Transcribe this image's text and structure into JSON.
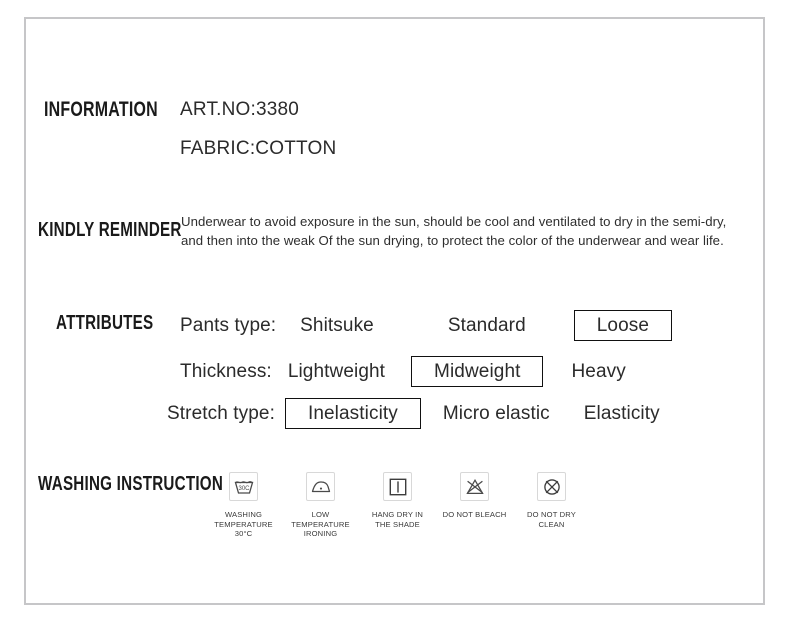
{
  "panel": {
    "border_color": "#c6c6c8",
    "text_color": "#2b2b2b"
  },
  "sections": {
    "information": {
      "heading": "INFORMATION",
      "art_no": "ART.NO:3380",
      "fabric": "FABRIC:COTTON"
    },
    "kindly_reminder": {
      "heading": "KINDLY REMINDER",
      "line1": "Underwear to avoid exposure in the sun, should be cool and ventilated to dry in the semi-dry,",
      "line2": "and then into the weak Of the sun drying, to protect the color of the underwear and wear life."
    },
    "attributes": {
      "heading": "ATTRIBUTES",
      "rows": [
        {
          "label": "Pants type:",
          "options": [
            {
              "text": "Shitsuke",
              "selected": false
            },
            {
              "text": "Standard",
              "selected": false
            },
            {
              "text": "Loose",
              "selected": true
            }
          ]
        },
        {
          "label": "Thickness:",
          "options": [
            {
              "text": "Lightweight",
              "selected": false
            },
            {
              "text": "Midweight",
              "selected": true
            },
            {
              "text": "Heavy",
              "selected": false
            }
          ]
        },
        {
          "label": "Stretch type:",
          "options": [
            {
              "text": "Inelasticity",
              "selected": true
            },
            {
              "text": "Micro elastic",
              "selected": false
            },
            {
              "text": "Elasticity",
              "selected": false
            }
          ]
        }
      ]
    },
    "washing_instruction": {
      "heading": "WASHING INSTRUCTION",
      "icons": [
        {
          "icon": "wash-tub-30c-icon",
          "caption": "WASHING\nTEMPERATURE 30°C"
        },
        {
          "icon": "low-temperature-iron-icon",
          "caption": "LOW TEMPERATURE\nIRONING"
        },
        {
          "icon": "hang-dry-shade-icon",
          "caption": "HANG DRY IN\nTHE SHADE"
        },
        {
          "icon": "do-not-bleach-icon",
          "caption": "DO NOT BLEACH"
        },
        {
          "icon": "do-not-dry-clean-icon",
          "caption": "DO NOT DRY\nCLEAN"
        }
      ]
    }
  }
}
